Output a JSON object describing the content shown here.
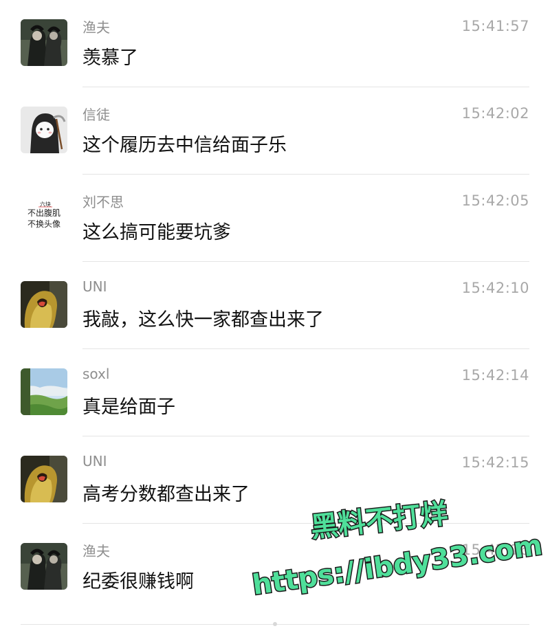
{
  "messages": [
    {
      "name": "渔夫",
      "time": "15:41:57",
      "text": "羡慕了",
      "avatar": "anime-dark-figure-avatar"
    },
    {
      "name": "信徒",
      "time": "15:42:02",
      "text": "这个履历去中信给面子乐",
      "avatar": "grim-reaper-cartoon-avatar"
    },
    {
      "name": "刘不思",
      "time": "15:42:05",
      "text": "这么搞可能要坑爹",
      "avatar": "text-avatar",
      "avatar_text": {
        "top": "六块",
        "middle": "不出腹肌",
        "bottom": "不换头像"
      }
    },
    {
      "name": "UNI",
      "time": "15:42:10",
      "text": "我敲，这么快一家都查出来了",
      "avatar": "lion-cub-avatar"
    },
    {
      "name": "soxl",
      "time": "15:42:14",
      "text": "真是给面子",
      "avatar": "mountain-landscape-avatar"
    },
    {
      "name": "UNI",
      "time": "15:42:15",
      "text": "高考分数都查出来了",
      "avatar": "lion-cub-avatar"
    },
    {
      "name": "渔夫",
      "time": "15:42:16",
      "text": "纪委很赚钱啊",
      "avatar": "anime-dark-figure-avatar"
    }
  ],
  "watermark": {
    "line1": "黑料不打烊",
    "line2": "https://ibdy33.com",
    "color": "#4fdf9a"
  }
}
